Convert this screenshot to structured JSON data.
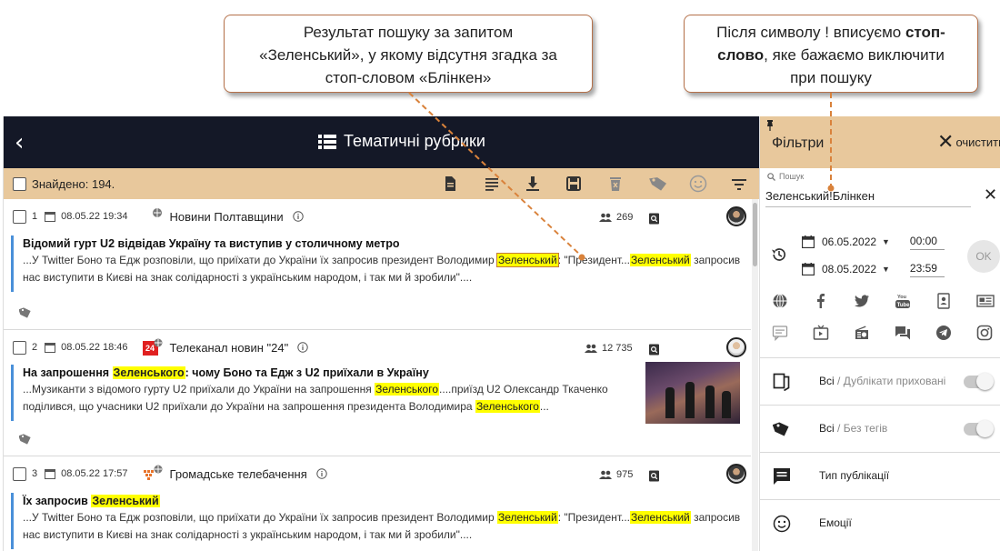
{
  "callouts": {
    "left": {
      "line1": "Результат пошуку за запитом",
      "line2": "«Зеленський», у якому відсутня згадка за",
      "line3": "стоп-словом «Блінкен»"
    },
    "right": {
      "line1_a": "Після символу ! вписуємо ",
      "line1_b": "стоп-",
      "line2_b": "слово",
      "line2_a": ", яке бажаємо виключити",
      "line3": "при пошуку"
    }
  },
  "header": {
    "back_icon": "chevron-left-icon",
    "title": "Тематичні рубрики",
    "title_icon": "list-icon"
  },
  "toolbar": {
    "found_label": "Знайдено: 194.",
    "icons": [
      "document-icon",
      "lines-icon",
      "download-icon",
      "save-icon",
      "delete-icon",
      "tag-icon",
      "emotion-icon",
      "sort-icon"
    ]
  },
  "items": [
    {
      "index": "1",
      "date": "08.05.22 19:34",
      "source": "Новини Полтавщини",
      "audience": "269",
      "title_parts": {
        "pre": "Відомий гурт U2 відвідав Україну та виступив у столичному метро"
      },
      "body_parts": {
        "a": "...У Twitter Боно та Едж розповіли, що приїхати до України їх запросив президент Володимир ",
        "h1": "Зеленський",
        "b": ": \"Президент...",
        "h2": "Зеленський",
        "c": " запросив нас виступити в Києві на знак солідарності з українським народом, і так ми й зробили\"...."
      }
    },
    {
      "index": "2",
      "date": "08.05.22 18:46",
      "source": "Телеканал новин \"24\"",
      "source_logo": "24",
      "audience": "12 735",
      "title_parts": {
        "pre": "На запрошення ",
        "hl": "Зеленського",
        "post": ": чому Боно та Едж з U2 приїхали в Україну"
      },
      "body_parts": {
        "a": "...Музиканти з відомого гурту U2 приїхали до України на запрошення ",
        "h1": "Зеленського",
        "b": "....приїзд U2 Олександр Ткаченко поділився, що учасники U2 приїхали до України на запрошення президента Володимира ",
        "h2": "Зеленського",
        "c": "..."
      }
    },
    {
      "index": "3",
      "date": "08.05.22 17:57",
      "source": "Громадське телебачення",
      "audience": "975",
      "title_parts": {
        "pre": "Їх запросив ",
        "hl": "Зеленський"
      },
      "body_parts": {
        "a": "...У Twitter Боно та Едж розповіли, що приїхати до України їх запросив президент Володимир ",
        "h1": "Зеленський",
        "b": ": \"Президент...",
        "h2": "Зеленський",
        "c": " запросив нас виступити в Києві на знак солідарності з українським народом, і так ми й зробили\"...."
      }
    }
  ],
  "filters": {
    "title": "Фільтри",
    "clear_label": "очистити",
    "search_label": "Пошук",
    "search_value": "Зеленський!Блінкен",
    "date_from": "06.05.2022",
    "time_from": "00:00",
    "date_to": "08.05.2022",
    "time_to": "23:59",
    "ok_label": "OK",
    "source_icons_row1": [
      "web-icon",
      "facebook-icon",
      "twitter-icon",
      "youtube-icon",
      "person-card-icon",
      "newspaper-icon"
    ],
    "source_icons_row2": [
      "comment-icon",
      "tv-icon",
      "radio-icon",
      "forum-icon",
      "telegram-icon",
      "instagram-icon"
    ],
    "rows": [
      {
        "icon": "duplicate-icon",
        "main": "Всі",
        "sep": " / ",
        "muted": "Дублікати приховані",
        "toggle": true
      },
      {
        "icon": "tag-icon",
        "main": "Всі",
        "sep": " / ",
        "muted": "Без тегів",
        "toggle": true
      },
      {
        "icon": "publication-type-icon",
        "main": "Тип публікації",
        "sep": "",
        "muted": "",
        "toggle": false
      },
      {
        "icon": "emotion-icon",
        "main": "Емоції",
        "sep": "",
        "muted": "",
        "toggle": false
      }
    ]
  }
}
